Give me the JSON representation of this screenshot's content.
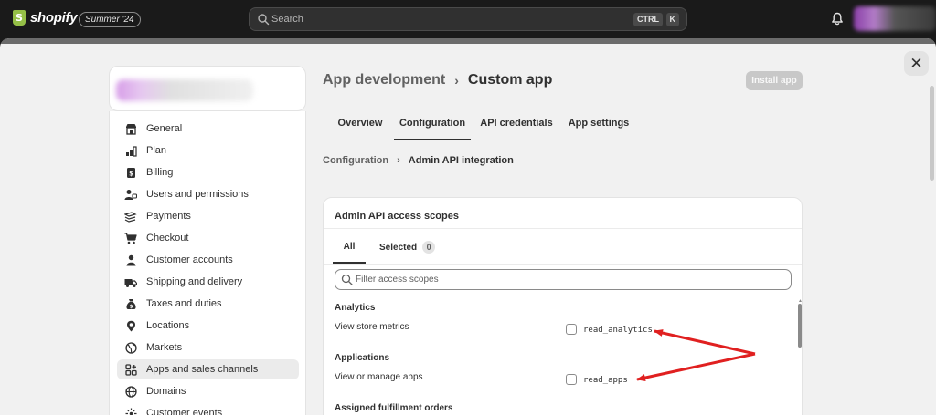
{
  "topbar": {
    "brand": "shopify",
    "edition": "Summer '24",
    "search_placeholder": "Search",
    "shortcut_ctrl": "CTRL",
    "shortcut_k": "K"
  },
  "sidebar": {
    "items": [
      {
        "label": "General",
        "icon": "store-icon"
      },
      {
        "label": "Plan",
        "icon": "plan-icon"
      },
      {
        "label": "Billing",
        "icon": "billing-icon"
      },
      {
        "label": "Users and permissions",
        "icon": "users-icon"
      },
      {
        "label": "Payments",
        "icon": "payments-icon"
      },
      {
        "label": "Checkout",
        "icon": "cart-icon"
      },
      {
        "label": "Customer accounts",
        "icon": "person-icon"
      },
      {
        "label": "Shipping and delivery",
        "icon": "truck-icon"
      },
      {
        "label": "Taxes and duties",
        "icon": "tax-icon"
      },
      {
        "label": "Locations",
        "icon": "location-icon"
      },
      {
        "label": "Markets",
        "icon": "globe-icon"
      },
      {
        "label": "Apps and sales channels",
        "icon": "apps-icon",
        "active": true
      },
      {
        "label": "Domains",
        "icon": "domain-icon"
      },
      {
        "label": "Customer events",
        "icon": "events-icon"
      }
    ]
  },
  "header": {
    "parent": "App development",
    "current": "Custom app",
    "install_label": "Install app"
  },
  "tabs": [
    "Overview",
    "Configuration",
    "API credentials",
    "App settings"
  ],
  "sub_breadcrumb": {
    "parent": "Configuration",
    "current": "Admin API integration"
  },
  "card": {
    "title": "Admin API access scopes",
    "tab_all": "All",
    "tab_selected": "Selected",
    "selected_count": "0",
    "filter_placeholder": "Filter access scopes",
    "sections": [
      {
        "title": "Analytics",
        "desc": "View store metrics",
        "scope": "read_analytics"
      },
      {
        "title": "Applications",
        "desc": "View or manage apps",
        "scope": "read_apps"
      },
      {
        "title": "Assigned fulfillment orders"
      }
    ]
  },
  "colors": {
    "annotation_arrow": "#e02020",
    "topbar": "#1a1a1a",
    "brand_green": "#95bf47"
  }
}
